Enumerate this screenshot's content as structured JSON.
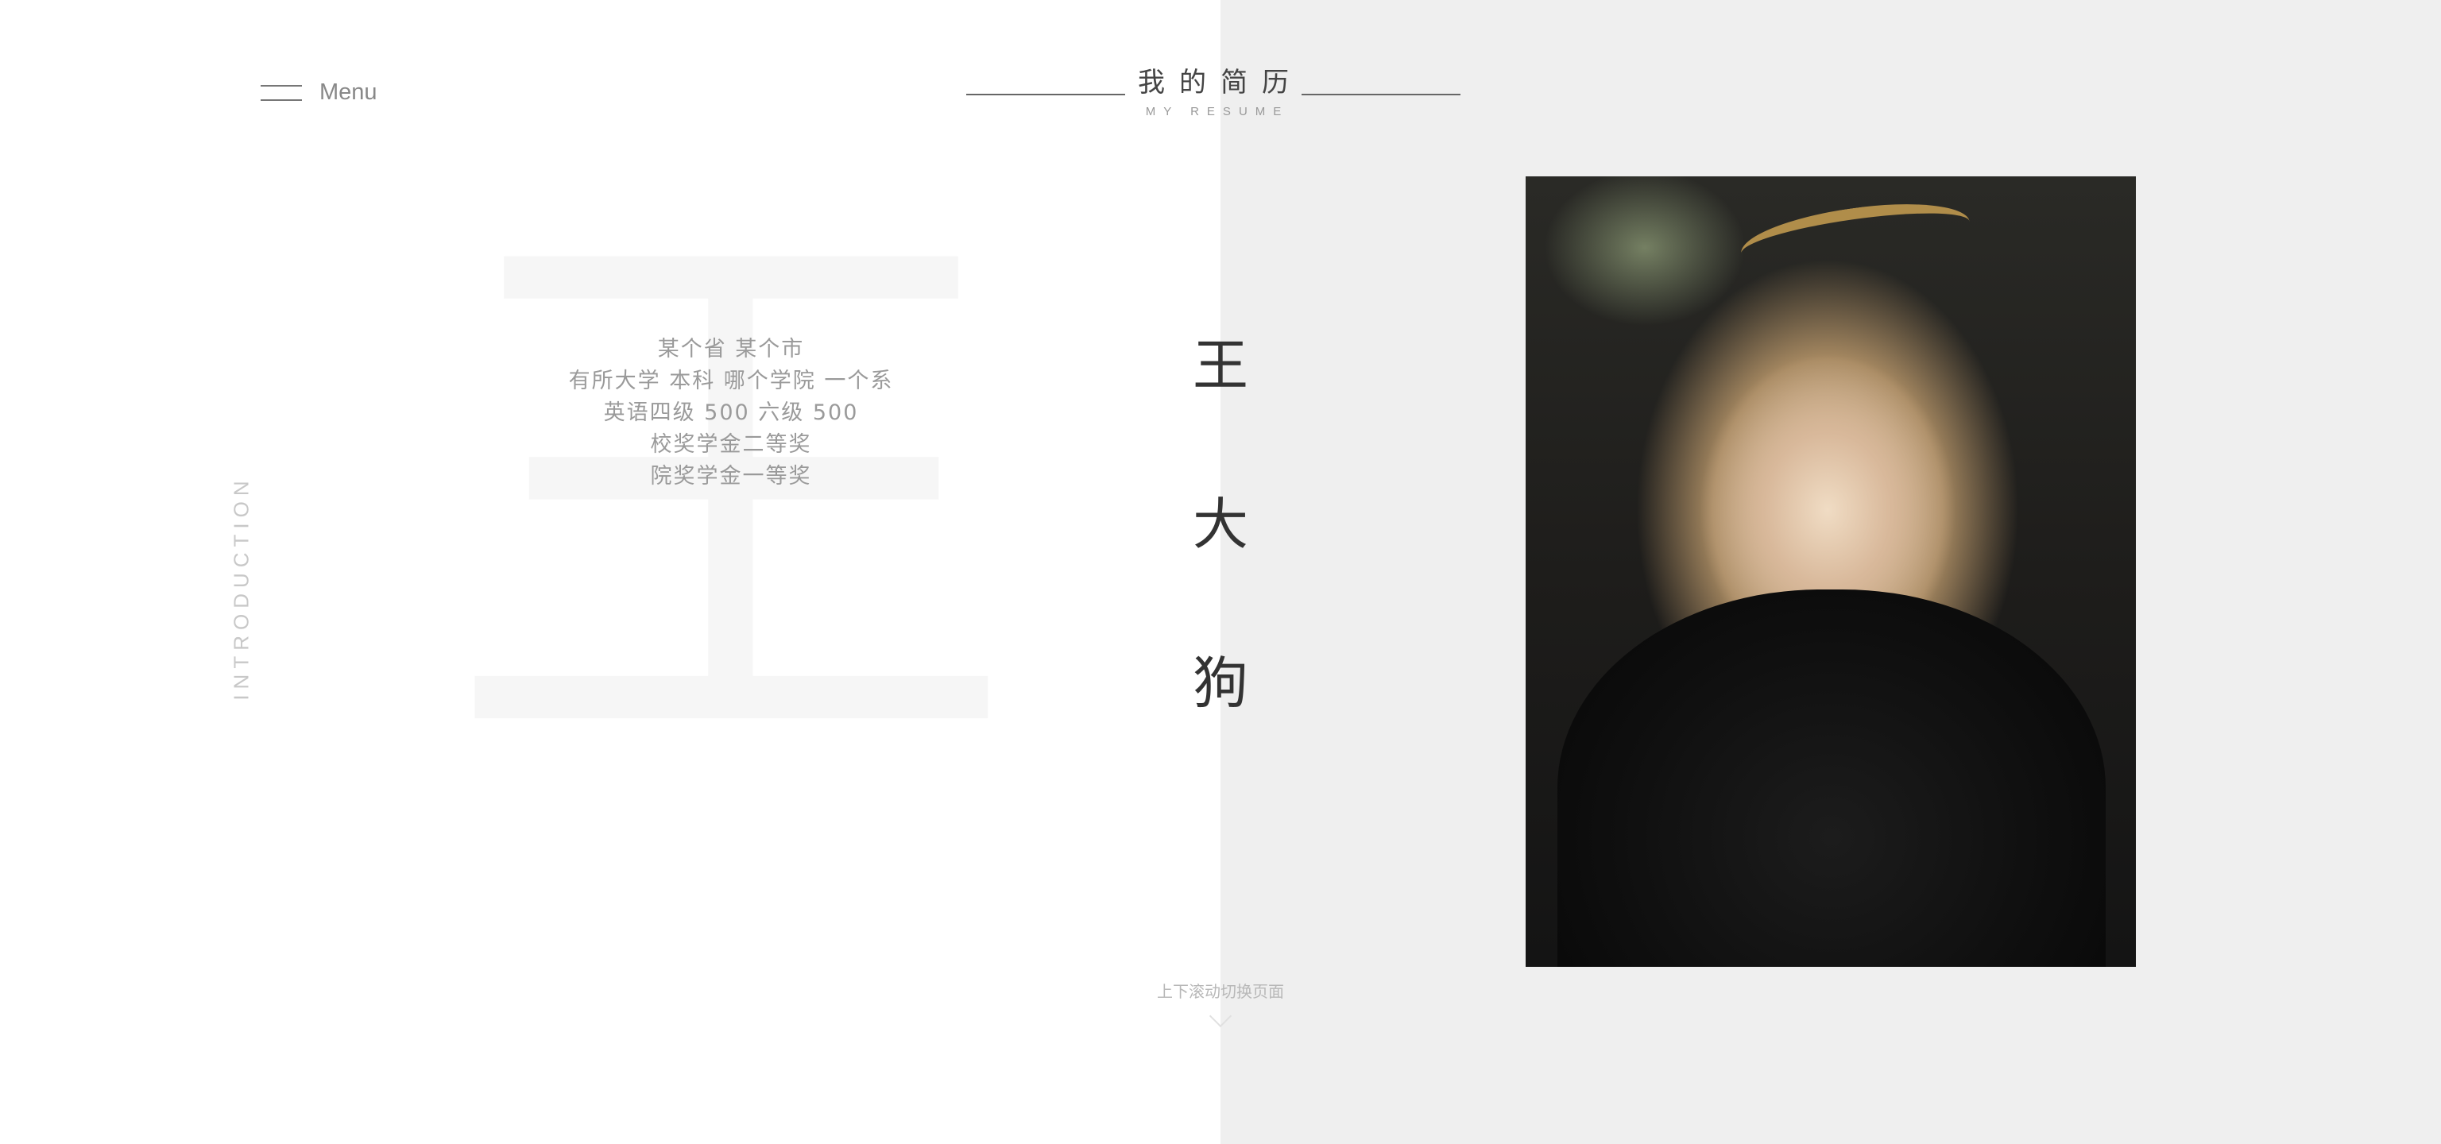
{
  "menu": {
    "label": "Menu"
  },
  "header": {
    "title_cn": "我的简历",
    "title_en": "MY RESUME"
  },
  "watermark": {
    "char": "王"
  },
  "intro": {
    "side_label": "INTRODUCTION",
    "lines": [
      "某个省 某个市",
      "有所大学 本科 哪个学院 一个系",
      "英语四级 500 六级 500",
      "校奖学金二等奖",
      "院奖学金一等奖"
    ]
  },
  "name": {
    "chars": [
      "王",
      "大",
      "狗"
    ]
  },
  "photo": {
    "alt": "portrait"
  },
  "scroll_hint": {
    "text": "上下滚动切换页面"
  },
  "colors": {
    "left_bg": "#ffffff",
    "right_bg": "#efefef",
    "text": "#555555"
  }
}
